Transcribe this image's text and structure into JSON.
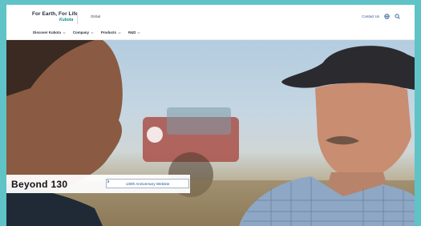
{
  "header": {
    "tagline": "For Earth, For Life",
    "brand": "Kubota",
    "region": "Global",
    "contact": "Contact Us",
    "globe_icon": "globe-icon",
    "search_icon": "search-icon"
  },
  "nav": {
    "items": [
      {
        "label": "Discover Kubota"
      },
      {
        "label": "Company"
      },
      {
        "label": "Products"
      },
      {
        "label": "R&D"
      }
    ]
  },
  "hero": {
    "title": "Beyond 130",
    "button_label": "130th Anniversary Website",
    "button_icon": "chevron-right-icon"
  },
  "colors": {
    "accent": "#0b8a8f",
    "link": "#1e4f8c",
    "frame_background": "#5fc3c7"
  }
}
